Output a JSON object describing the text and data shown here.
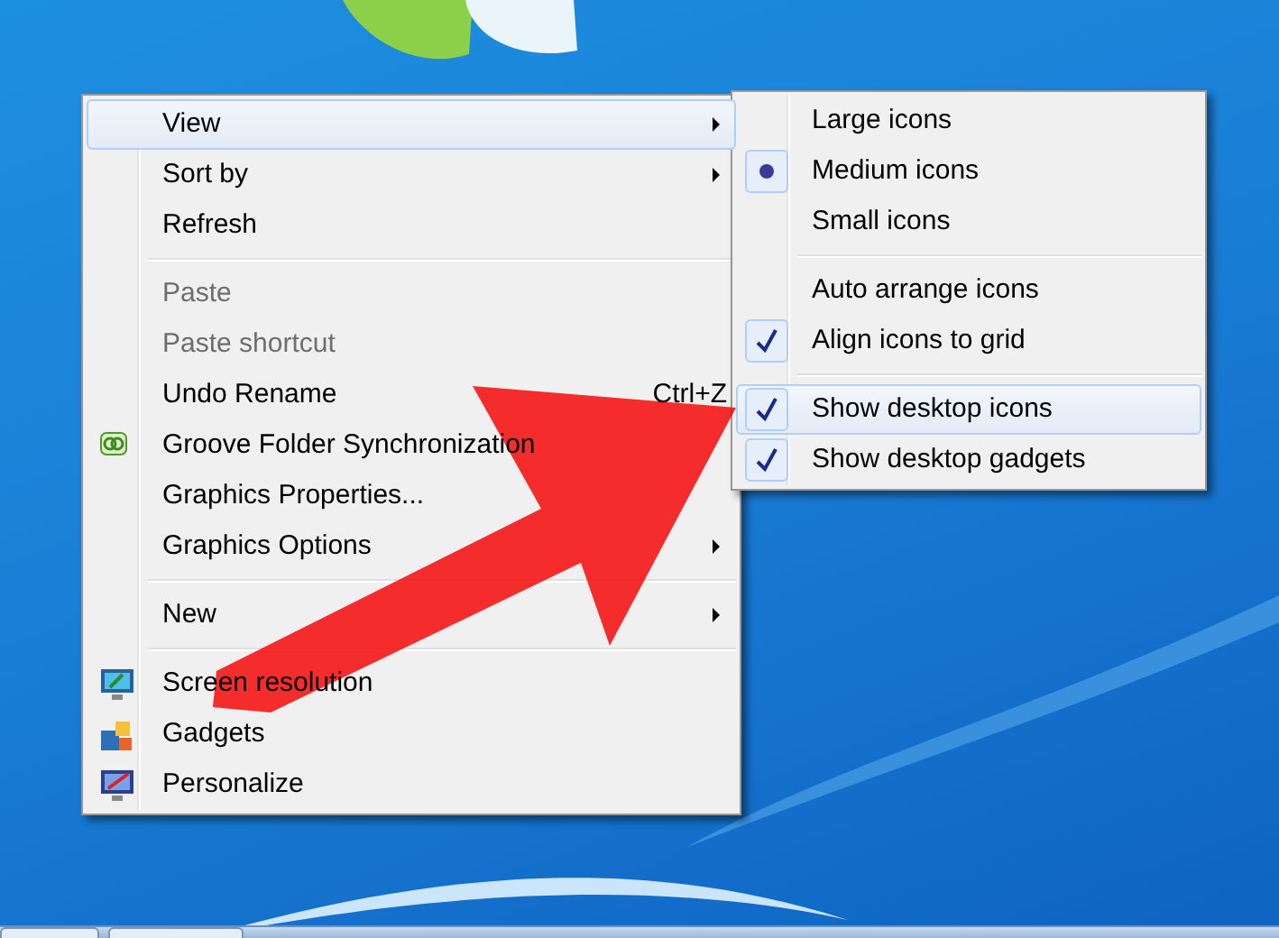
{
  "context_menu": {
    "items": [
      {
        "kind": "item",
        "label": "View",
        "submenu": true,
        "highlighted": true,
        "disabled": false
      },
      {
        "kind": "item",
        "label": "Sort by",
        "submenu": true,
        "highlighted": false,
        "disabled": false
      },
      {
        "kind": "item",
        "label": "Refresh",
        "submenu": false,
        "highlighted": false,
        "disabled": false
      },
      {
        "kind": "separator"
      },
      {
        "kind": "item",
        "label": "Paste",
        "submenu": false,
        "highlighted": false,
        "disabled": true
      },
      {
        "kind": "item",
        "label": "Paste shortcut",
        "submenu": false,
        "highlighted": false,
        "disabled": true
      },
      {
        "kind": "item",
        "label": "Undo Rename",
        "shortcut": "Ctrl+Z",
        "submenu": false,
        "highlighted": false,
        "disabled": false
      },
      {
        "kind": "item",
        "label": "Groove Folder Synchronization",
        "submenu": false,
        "highlighted": false,
        "disabled": false
      },
      {
        "kind": "item",
        "label": "Graphics Properties...",
        "submenu": false,
        "highlighted": false,
        "disabled": false
      },
      {
        "kind": "item",
        "label": "Graphics Options",
        "submenu": true,
        "highlighted": false,
        "disabled": false
      },
      {
        "kind": "separator"
      },
      {
        "kind": "item",
        "label": "New",
        "submenu": true,
        "highlighted": false,
        "disabled": false
      },
      {
        "kind": "separator"
      },
      {
        "kind": "item",
        "label": "Screen resolution",
        "submenu": false,
        "highlighted": false,
        "disabled": false
      },
      {
        "kind": "item",
        "label": "Gadgets",
        "submenu": false,
        "highlighted": false,
        "disabled": false
      },
      {
        "kind": "item",
        "label": "Personalize",
        "submenu": false,
        "highlighted": false,
        "disabled": false
      }
    ]
  },
  "view_submenu": {
    "items": [
      {
        "kind": "radio",
        "label": "Large icons",
        "selected": false,
        "highlighted": false
      },
      {
        "kind": "radio",
        "label": "Medium icons",
        "selected": true,
        "highlighted": false
      },
      {
        "kind": "radio",
        "label": "Small icons",
        "selected": false,
        "highlighted": false
      },
      {
        "kind": "separator"
      },
      {
        "kind": "check",
        "label": "Auto arrange icons",
        "checked": false,
        "highlighted": false
      },
      {
        "kind": "check",
        "label": "Align icons to grid",
        "checked": true,
        "highlighted": false
      },
      {
        "kind": "separator"
      },
      {
        "kind": "check",
        "label": "Show desktop icons",
        "checked": true,
        "highlighted": true
      },
      {
        "kind": "check",
        "label": "Show desktop gadgets",
        "checked": true,
        "highlighted": false
      }
    ]
  }
}
